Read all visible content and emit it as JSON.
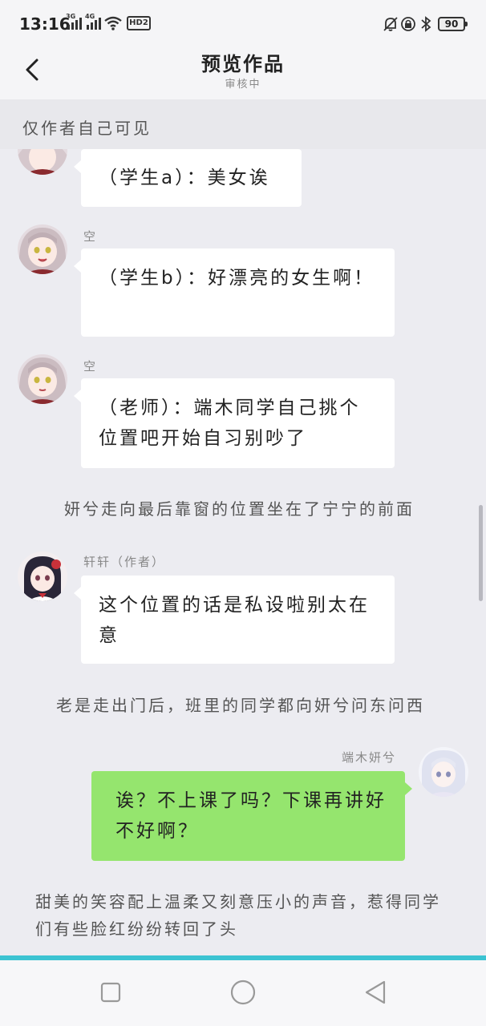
{
  "status_bar": {
    "time": "13:16",
    "signal_1_label": "3G",
    "signal_2_label": "4G",
    "network_badge": "HD2",
    "battery": "90"
  },
  "header": {
    "title": "预览作品",
    "subtitle": "审核中"
  },
  "visibility_notice": "仅作者自己可见",
  "messages": [
    {
      "sender": "",
      "text": "（学生a）：美女诶"
    },
    {
      "sender": "空",
      "text": "（学生b）：好漂亮的女生啊！"
    },
    {
      "sender": "空",
      "text": "（老师）：端木同学自己挑个位置吧开始自习别吵了"
    },
    {
      "narration": "妍兮走向最后靠窗的位置坐在了宁宁的前面"
    },
    {
      "sender": "轩轩（作者）",
      "text": "这个位置的话是私设啦别太在意"
    },
    {
      "narration": "老是走出门后，班里的同学都向妍兮问东问西"
    },
    {
      "sender": "端木妍兮",
      "text": "诶？不上课了吗？下课再讲好不好啊？"
    },
    {
      "narration": "甜美的笑容配上温柔又刻意压小的声音，惹得同学们有些脸红纷纷转回了头"
    }
  ],
  "colors": {
    "own_bubble": "#95e56e",
    "accent_line": "#3cc3d2",
    "chat_background": "#ececf1"
  },
  "nav": {
    "icons": [
      "square-icon",
      "circle-icon",
      "triangle-back-icon"
    ]
  }
}
